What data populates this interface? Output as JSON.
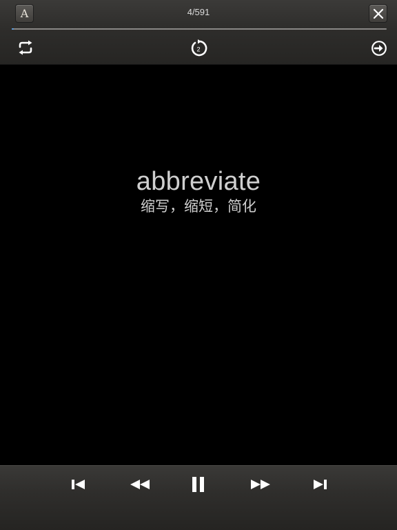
{
  "header": {
    "font_button_label": "A",
    "counter": "4/591",
    "progress_fraction": 0.006,
    "icons": [
      "repeat-icon",
      "replay-count-icon",
      "next-circle-icon",
      "close-icon"
    ],
    "replay_count": "2"
  },
  "card": {
    "word": "abbreviate",
    "meaning": "缩写，缩短，简化"
  },
  "controls": {
    "icons": [
      "skip-previous-icon",
      "rewind-icon",
      "pause-icon",
      "fast-forward-icon",
      "skip-next-icon"
    ]
  },
  "colors": {
    "accent": "#5aa0e8",
    "text": "#cfcfcf",
    "bar": "#2f2e2c",
    "background": "#000000"
  }
}
